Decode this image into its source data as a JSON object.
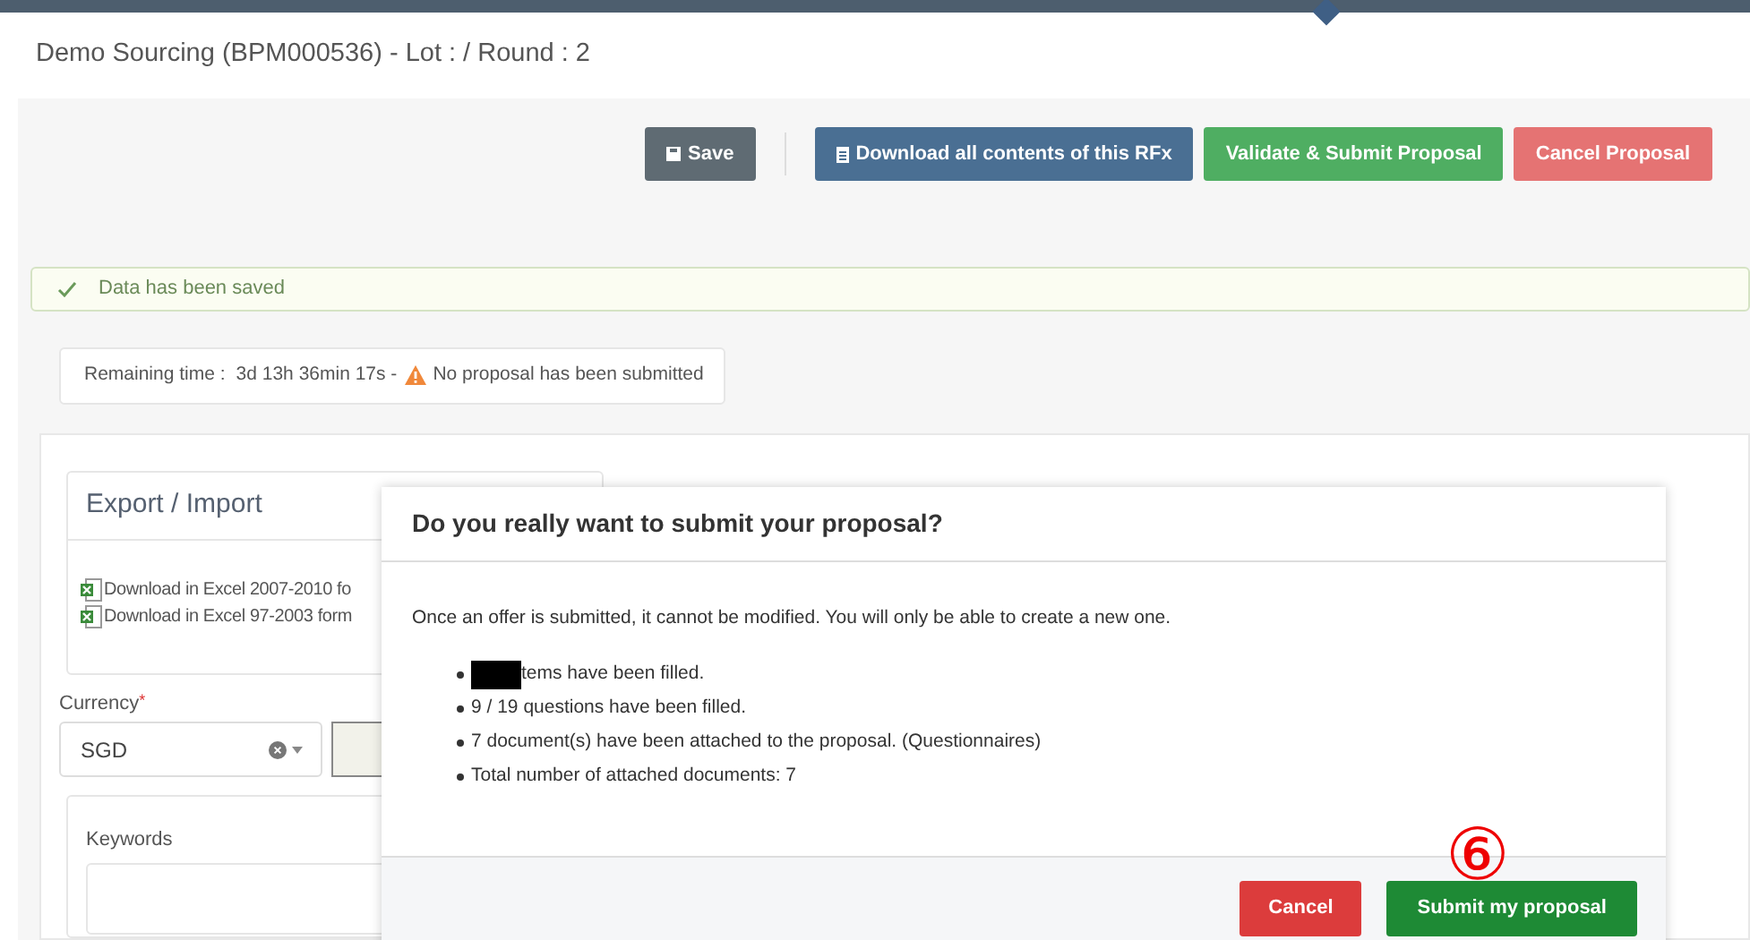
{
  "header": {
    "title": "Demo Sourcing (BPM000536) - Lot : / Round : 2"
  },
  "toolbar": {
    "buttons": [
      {
        "label": "Save",
        "kind": "save"
      },
      {
        "label": "Download all contents of this RFx",
        "kind": "download"
      },
      {
        "label": "Validate & Submit Proposal",
        "kind": "validate"
      },
      {
        "label": "Cancel Proposal",
        "kind": "cancel"
      }
    ]
  },
  "alert": {
    "text": "Data has been saved"
  },
  "status": {
    "label": "Remaining time :",
    "time": "3d 13h 36min 17s -",
    "warning": "No proposal has been submitted"
  },
  "export_import": {
    "title": "Export / Import",
    "links": [
      "Download in Excel 2007-2010 fo",
      "Download in Excel 97-2003 form"
    ]
  },
  "currency": {
    "label": "Currency",
    "required_mark": "*",
    "value": "SGD"
  },
  "keywords": {
    "label": "Keywords"
  },
  "modal": {
    "title": "Do you really want to submit your proposal?",
    "message": "Once an offer is submitted, it cannot be modified. You will only be able to create a new one.",
    "items": [
      {
        "text": "tems have been filled.",
        "redacted": true
      },
      {
        "text": "9 / 19 questions have been filled.",
        "redacted": false
      },
      {
        "text": "7 document(s) have been attached to the proposal. (Questionnaires)",
        "redacted": false
      },
      {
        "text": "Total number of attached documents: 7",
        "redacted": false
      }
    ],
    "annotation": "⑥",
    "buttons": [
      {
        "label": "Cancel",
        "kind": "cancel"
      },
      {
        "label": "Submit my proposal",
        "kind": "submit"
      }
    ]
  }
}
